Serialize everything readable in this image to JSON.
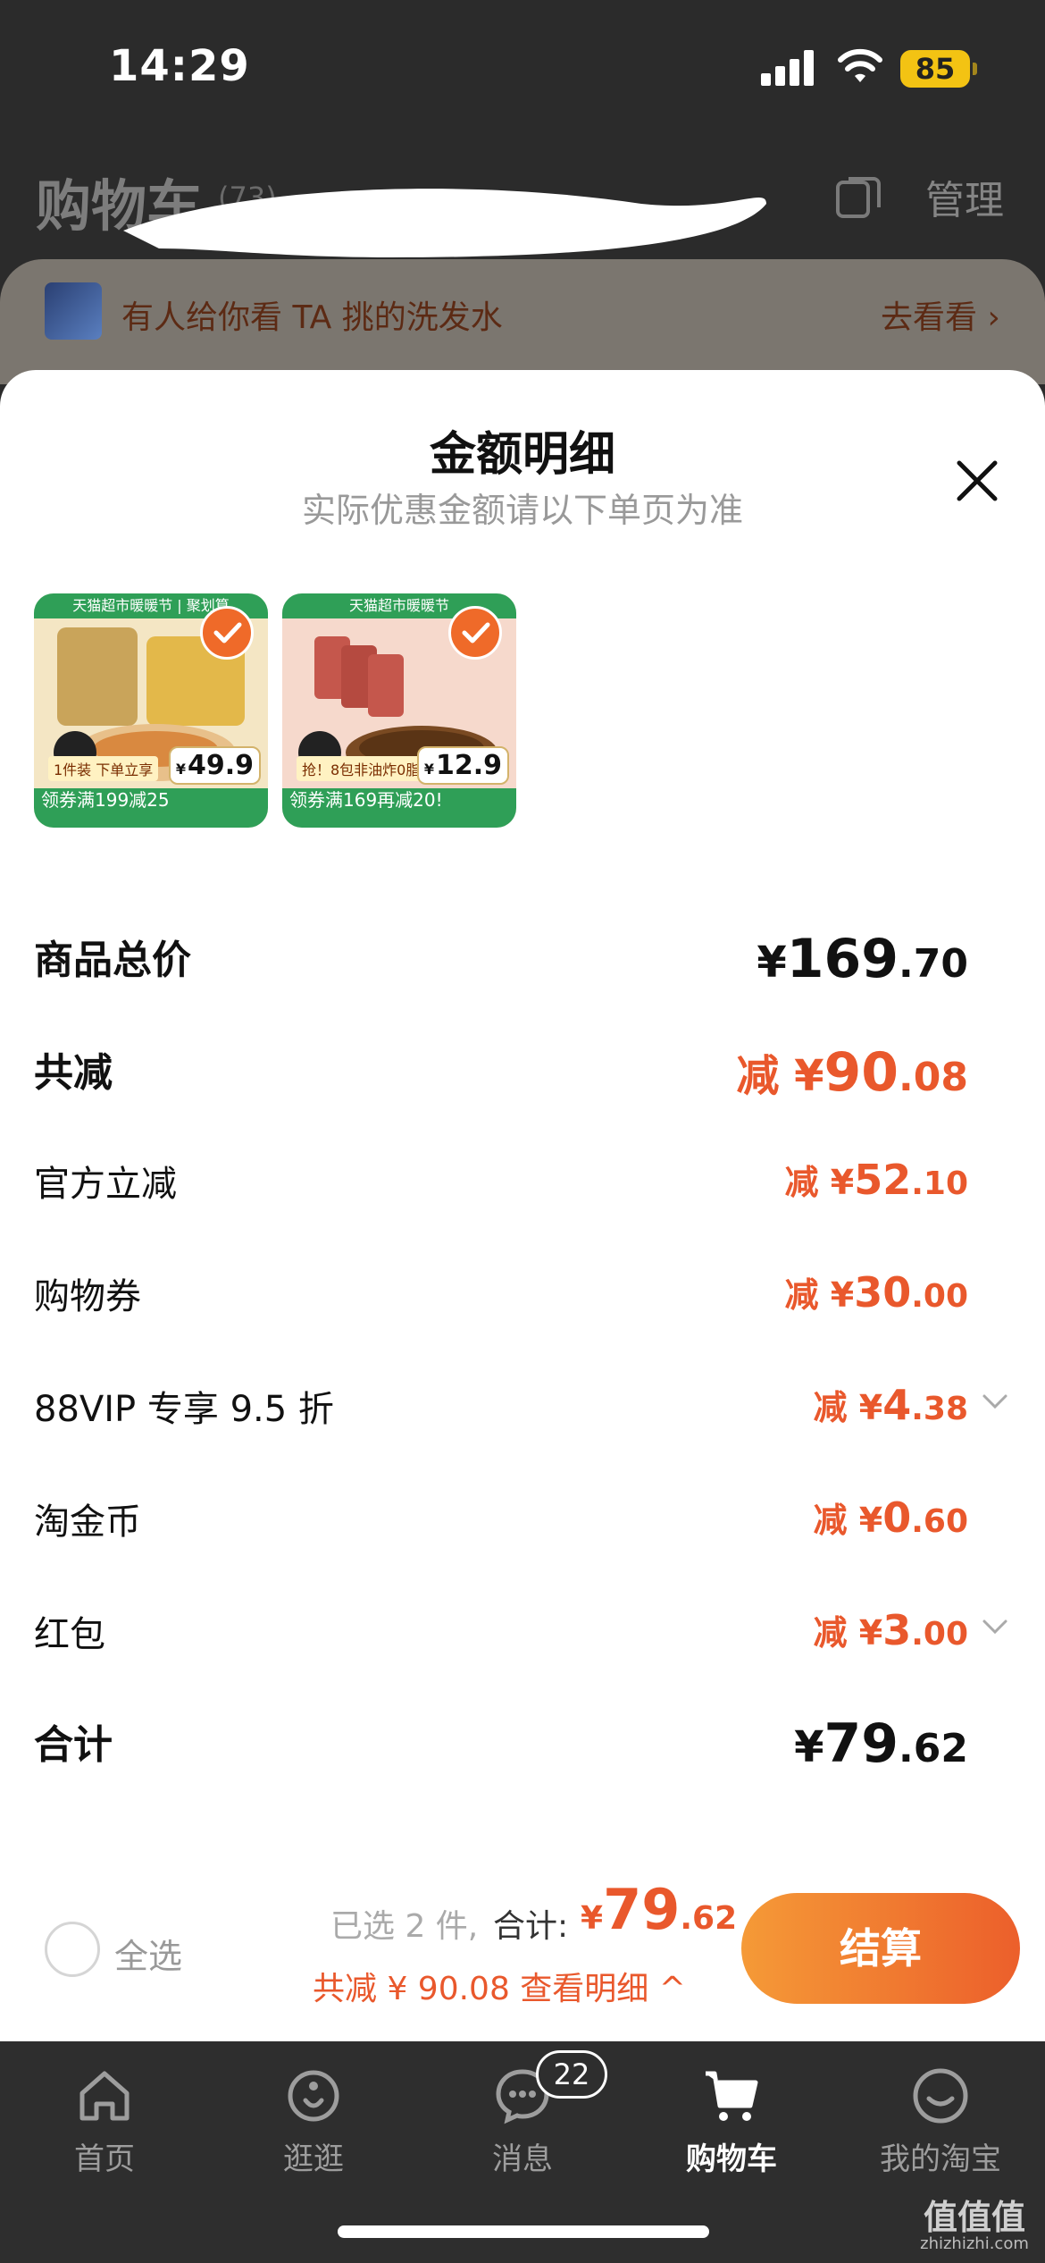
{
  "status_bar": {
    "time": "14:29",
    "battery": "85"
  },
  "cart_header": {
    "title": "购物车",
    "count": "(73)",
    "manage": "管理"
  },
  "banner": {
    "text": "有人给你看 TA 挑的洗发水",
    "link": "去看看"
  },
  "sheet": {
    "title": "金额明细",
    "subtitle": "实际优惠金额请以下单页为准",
    "products": [
      {
        "top_text": "天猫超市暖暖节 | 聚划算",
        "label": "1件装 下单立享",
        "price": "49.9",
        "coupon": "领券满199减25"
      },
      {
        "top_text": "天猫超市暖暖节",
        "label": "抢！8包非油炸0脂面饼",
        "price": "12.9",
        "coupon": "领券满169再减20!"
      }
    ],
    "rows": [
      {
        "label": "商品总价",
        "prefix": "",
        "currency": "¥",
        "int": "169",
        "dec": ".70"
      },
      {
        "label": "共减",
        "prefix": "减 ",
        "currency": "¥",
        "int": "90",
        "dec": ".08"
      },
      {
        "label": "官方立减",
        "prefix": "减 ",
        "currency": "¥",
        "int": "52",
        "dec": ".10"
      },
      {
        "label": "购物券",
        "prefix": "减 ",
        "currency": "¥",
        "int": "30",
        "dec": ".00"
      },
      {
        "label": "88VIP 专享 9.5 折",
        "prefix": "减 ",
        "currency": "¥",
        "int": "4",
        "dec": ".38"
      },
      {
        "label": "淘金币",
        "prefix": "减 ",
        "currency": "¥",
        "int": "0",
        "dec": ".60"
      },
      {
        "label": "红包",
        "prefix": "减 ",
        "currency": "¥",
        "int": "3",
        "dec": ".00"
      },
      {
        "label": "合计",
        "prefix": "",
        "currency": "¥",
        "int": "79",
        "dec": ".62"
      }
    ]
  },
  "bottom_bar": {
    "select_all": "全选",
    "selected_count": "已选 2 件,",
    "total_label": "合计:",
    "total_currency": "¥",
    "total_int": "79",
    "total_dec": ".62",
    "discount_line": "共减 ¥ 90.08  查看明细 ^",
    "checkout": "结算"
  },
  "tab_bar": {
    "tabs": [
      {
        "label": "首页",
        "icon": "home-icon"
      },
      {
        "label": "逛逛",
        "icon": "stroll-icon"
      },
      {
        "label": "消息",
        "icon": "message-icon"
      },
      {
        "label": "购物车",
        "icon": "cart-icon"
      },
      {
        "label": "我的淘宝",
        "icon": "profile-icon"
      }
    ],
    "active_index": 3,
    "message_badge": "22"
  },
  "watermark": {
    "main": "值值值",
    "sub": "zhizhizhi.com"
  },
  "colors": {
    "accent": "#e9582c",
    "checkout_start": "#f59a37",
    "checkout_end": "#ec5f2b",
    "tab_bar": "#2e2e2e"
  }
}
